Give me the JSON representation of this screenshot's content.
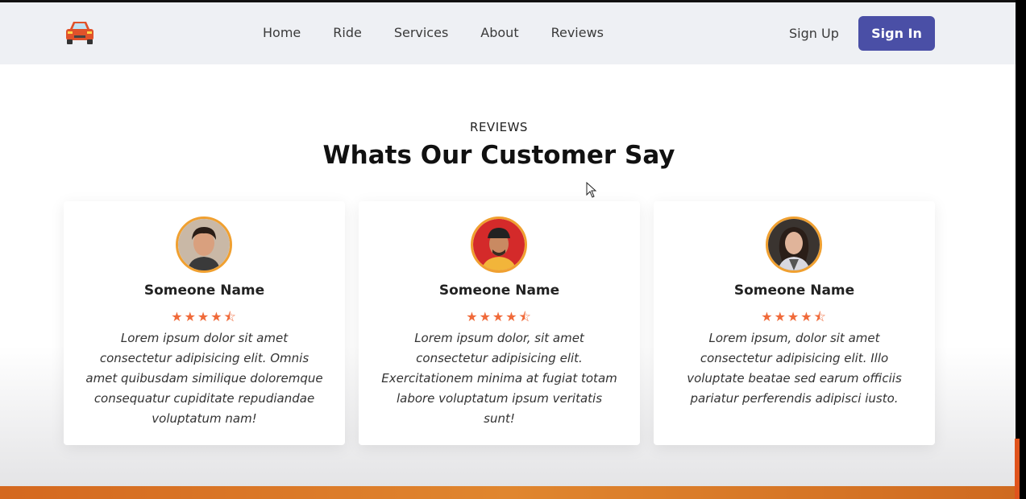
{
  "nav": {
    "items": [
      "Home",
      "Ride",
      "Services",
      "About",
      "Reviews"
    ],
    "signup_label": "Sign Up",
    "signin_label": "Sign In"
  },
  "section": {
    "label": "REVIEWS",
    "title": "Whats Our Customer Say"
  },
  "reviews": [
    {
      "name": "Someone Name",
      "rating": 4.5,
      "stars": "★★★★⯪",
      "text": "Lorem ipsum dolor sit amet consectetur adipisicing elit. Omnis amet quibusdam similique doloremque consequatur cupiditate repudiandae voluptatum nam!"
    },
    {
      "name": "Someone Name",
      "rating": 4.5,
      "stars": "★★★★⯪",
      "text": "Lorem ipsum dolor, sit amet consectetur adipisicing elit. Exercitationem minima at fugiat totam labore voluptatum ipsum veritatis sunt!"
    },
    {
      "name": "Someone Name",
      "rating": 4.5,
      "stars": "★★★★⯪",
      "text": "Lorem ipsum, dolor sit amet consectetur adipisicing elit. Illo voluptate beatae sed earum officiis pariatur perferendis adipisci iusto."
    }
  ],
  "colors": {
    "accent": "#4a4fa6",
    "star": "#f06a3a",
    "avatar_border": "#f0a030",
    "bottom_bar": "#d4681f"
  },
  "icons": {
    "logo": "car-icon",
    "cursor": "mouse-pointer-icon"
  }
}
